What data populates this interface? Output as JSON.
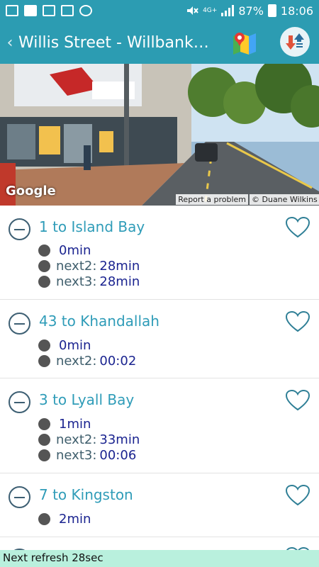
{
  "status_bar": {
    "network_label": "4G+",
    "battery": "87%",
    "time": "18:06"
  },
  "app_bar": {
    "back_glyph": "‹",
    "title": "Willis Street - Willbank Co..."
  },
  "street_view": {
    "logo": "Google",
    "report": "Report a problem",
    "credit": "© Duane Wilkins"
  },
  "routes": [
    {
      "name": "1 to Island Bay",
      "times": [
        {
          "label": "",
          "value": "0min"
        },
        {
          "label": "next2:",
          "value": "28min"
        },
        {
          "label": "next3:",
          "value": "28min"
        }
      ]
    },
    {
      "name": "43 to Khandallah",
      "times": [
        {
          "label": "",
          "value": "0min"
        },
        {
          "label": "next2:",
          "value": "00:02"
        }
      ]
    },
    {
      "name": "3 to Lyall Bay",
      "times": [
        {
          "label": "",
          "value": "1min"
        },
        {
          "label": "next2:",
          "value": "33min"
        },
        {
          "label": "next3:",
          "value": "00:06"
        }
      ]
    },
    {
      "name": "7 to Kingston",
      "times": [
        {
          "label": "",
          "value": "2min"
        }
      ]
    }
  ],
  "footer": {
    "text": "Next refresh 28sec"
  },
  "colors": {
    "accent": "#2c9cb2",
    "route_text": "#2f9cb8",
    "time_value": "#1b2490",
    "footer_bg": "#b9f0dd"
  }
}
